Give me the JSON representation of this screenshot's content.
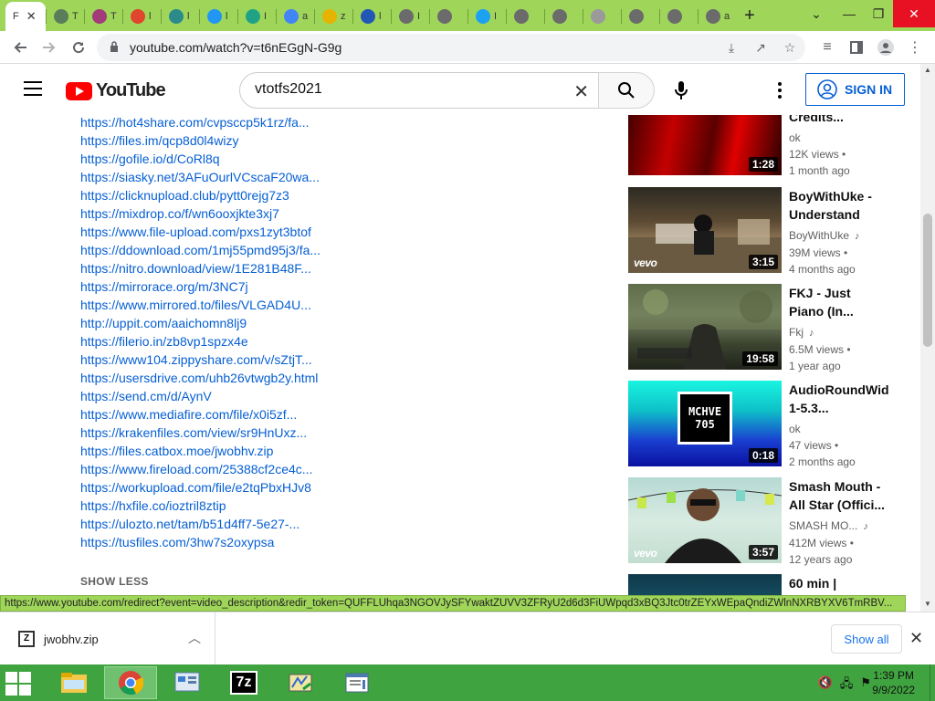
{
  "browser": {
    "active_tab_label": "F",
    "tabs": [
      {
        "fav": "chrome-circle-icon",
        "color": "#5a7d5a",
        "txt": "T"
      },
      {
        "fav": "hearts-icon",
        "color": "#a33a7a",
        "txt": "T"
      },
      {
        "fav": "target-icon",
        "color": "#e0452e",
        "txt": "l"
      },
      {
        "fav": "feather-icon",
        "color": "#2c8a8a",
        "txt": "l"
      },
      {
        "fav": "arrow-icon",
        "color": "#2196f3",
        "txt": "l"
      },
      {
        "fav": "s-icon",
        "color": "#1fa384",
        "txt": "I"
      },
      {
        "fav": "google-icon",
        "color": "#4285f4",
        "txt": "a"
      },
      {
        "fav": "folder-icon",
        "color": "#e6b300",
        "txt": "z"
      },
      {
        "fav": "up-icon",
        "color": "#2257b5",
        "txt": "l"
      },
      {
        "fav": "globe-icon",
        "color": "#6b6b6b",
        "txt": "I"
      },
      {
        "fav": "globe-icon",
        "color": "#6b6b6b",
        "txt": ""
      },
      {
        "fav": "twitter-icon",
        "color": "#1da1f2",
        "txt": "I"
      },
      {
        "fav": "globe-icon",
        "color": "#6b6b6b",
        "txt": ""
      },
      {
        "fav": "globe-icon",
        "color": "#6b6b6b",
        "txt": ""
      },
      {
        "fav": "globe-icon",
        "color": "#9a9a9a",
        "txt": ""
      },
      {
        "fav": "globe-icon",
        "color": "#6b6b6b",
        "txt": ""
      },
      {
        "fav": "globe-icon",
        "color": "#6b6b6b",
        "txt": ""
      },
      {
        "fav": "globe-icon",
        "color": "#6b6b6b",
        "txt": "a"
      }
    ],
    "new_tab": "+",
    "url": "youtube.com/watch?v=t6nEGgN-G9g"
  },
  "youtube": {
    "logo_text": "YouTube",
    "search_value": "vtotfs2021",
    "signin_label": "SIGN IN"
  },
  "description": {
    "links": [
      "https://hot4share.com/cvpsccp5k1rz/fa...",
      "https://files.im/qcp8d0l4wizy",
      "https://gofile.io/d/CoRl8q",
      "https://siasky.net/3AFuOurlVCscaF20wa...",
      "https://clicknupload.club/pytt0rejg7z3",
      "https://mixdrop.co/f/wn6ooxjkte3xj7",
      "https://www.file-upload.com/pxs1zyt3btof",
      "https://ddownload.com/1mj55pmd95j3/fa...",
      "https://nitro.download/view/1E281B48F...",
      "https://mirrorace.org/m/3NC7j",
      "https://www.mirrored.to/files/VLGAD4U...",
      "http://uppit.com/aaichomn8lj9",
      "https://filerio.in/zb8vp1spzx4e",
      "https://www104.zippyshare.com/v/sZtjT...",
      "https://usersdrive.com/uhb26vtwgb2y.html",
      "https://send.cm/d/AynV",
      "https://www.mediafire.com/file/x0i5zf...",
      "https://krakenfiles.com/view/sr9HnUxz...",
      "https://files.catbox.moe/jwobhv.zip",
      "https://www.fireload.com/25388cf2ce4c...",
      "https://workupload.com/file/e2tqPbxHJv8",
      "https://hxfile.co/ioztril8ztip",
      "https://ulozto.net/tam/b51d4ff7-5e27-...",
      "https://tusfiles.com/3hw7s2oxypsa"
    ],
    "show_less": "SHOW LESS"
  },
  "related": [
    {
      "title1": "Credits...",
      "title2": "",
      "channel": "ok",
      "views": "12K views •",
      "age": "1 month ago",
      "duration": "1:28",
      "vevo": "",
      "music": false
    },
    {
      "title1": "BoyWithUke -",
      "title2": "Understand",
      "channel": "BoyWithUke",
      "views": "39M views •",
      "age": "4 months ago",
      "duration": "3:15",
      "vevo": "vevo",
      "music": true
    },
    {
      "title1": "FKJ - Just",
      "title2": "Piano (In...",
      "channel": "Fkj",
      "views": "6.5M views •",
      "age": "1 year ago",
      "duration": "19:58",
      "vevo": "",
      "music": true
    },
    {
      "title1": "AudioRoundWid",
      "title2": "1-5.3...",
      "channel": "ok",
      "views": "47 views •",
      "age": "2 months ago",
      "duration": "0:18",
      "vevo": "",
      "music": false,
      "thumb_text1": "MCHVE",
      "thumb_text2": "705"
    },
    {
      "title1": "Smash Mouth -",
      "title2": "All Star (Offici...",
      "channel": "SMASH MO...",
      "views": "412M views •",
      "age": "12 years ago",
      "duration": "3:57",
      "vevo": "vevo",
      "music": true
    },
    {
      "title1": "60 min |",
      "title2": "",
      "channel": "",
      "views": "",
      "age": "",
      "duration": "",
      "vevo": "",
      "music": false
    }
  ],
  "status_url": "https://www.youtube.com/redirect?event=video_description&redir_token=QUFFLUhqa3NGOVJySFYwaktZUVV3ZFRyU2d6d3FiUWpqd3xBQ3Jtc0trZEYxWEpaQndiZWlnNXRBYXV6TmRBV...",
  "downloads": {
    "file_name": "jwobhv.zip",
    "show_all": "Show all"
  },
  "taskbar": {
    "time": "1:39 PM",
    "date": "9/9/2022"
  }
}
